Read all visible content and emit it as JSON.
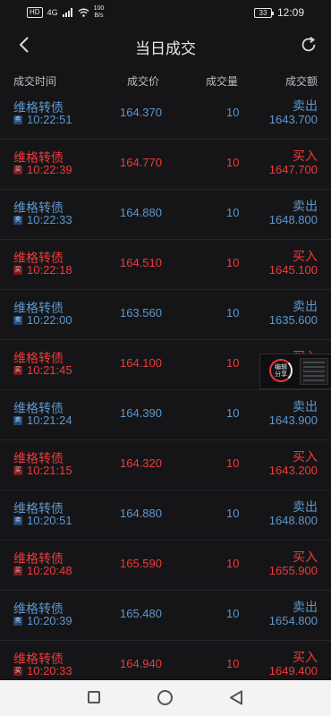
{
  "status_bar": {
    "hd": "HD",
    "network": "4G",
    "speed": [
      "100",
      "B/s"
    ],
    "battery": "33",
    "time": "12:09"
  },
  "header": {
    "title": "当日成交",
    "back_icon": "chevron-left-icon",
    "refresh_icon": "refresh-icon"
  },
  "columns": {
    "time": "成交时间",
    "price": "成交价",
    "qty": "成交量",
    "amount": "成交额"
  },
  "trades": [
    {
      "name": "维格转债",
      "badge": "卖",
      "time": "10:22:51",
      "price": "164.370",
      "qty": "10",
      "side": "卖出",
      "amount": "1643.700",
      "type": "sell"
    },
    {
      "name": "维格转债",
      "badge": "买",
      "time": "10:22:39",
      "price": "164.770",
      "qty": "10",
      "side": "买入",
      "amount": "1647.700",
      "type": "buy"
    },
    {
      "name": "维格转债",
      "badge": "卖",
      "time": "10:22:33",
      "price": "164.880",
      "qty": "10",
      "side": "卖出",
      "amount": "1648.800",
      "type": "sell"
    },
    {
      "name": "维格转债",
      "badge": "买",
      "time": "10:22:18",
      "price": "164.510",
      "qty": "10",
      "side": "买入",
      "amount": "1645.100",
      "type": "buy"
    },
    {
      "name": "维格转债",
      "badge": "卖",
      "time": "10:22:00",
      "price": "163.560",
      "qty": "10",
      "side": "卖出",
      "amount": "1635.600",
      "type": "sell"
    },
    {
      "name": "维格转债",
      "badge": "买",
      "time": "10:21:45",
      "price": "164.100",
      "qty": "10",
      "side": "买入",
      "amount": "",
      "type": "buy"
    },
    {
      "name": "维格转债",
      "badge": "卖",
      "time": "10:21:24",
      "price": "164.390",
      "qty": "10",
      "side": "卖出",
      "amount": "1643.900",
      "type": "sell"
    },
    {
      "name": "维格转债",
      "badge": "买",
      "time": "10:21:15",
      "price": "164.320",
      "qty": "10",
      "side": "买入",
      "amount": "1643.200",
      "type": "buy"
    },
    {
      "name": "维格转债",
      "badge": "卖",
      "time": "10:20:51",
      "price": "164.880",
      "qty": "10",
      "side": "卖出",
      "amount": "1648.800",
      "type": "sell"
    },
    {
      "name": "维格转债",
      "badge": "买",
      "time": "10:20:48",
      "price": "165.590",
      "qty": "10",
      "side": "买入",
      "amount": "1655.900",
      "type": "buy"
    },
    {
      "name": "维格转债",
      "badge": "卖",
      "time": "10:20:39",
      "price": "165.480",
      "qty": "10",
      "side": "卖出",
      "amount": "1654.800",
      "type": "sell"
    },
    {
      "name": "维格转债",
      "badge": "买",
      "time": "10:20:33",
      "price": "164.940",
      "qty": "10",
      "side": "买入",
      "amount": "1649.400",
      "type": "buy"
    }
  ],
  "float_share": {
    "line1": "编辑",
    "line2": "分享"
  },
  "nav": {
    "recent_icon": "square-icon",
    "home_icon": "circle-icon",
    "back_icon": "triangle-back-icon"
  }
}
